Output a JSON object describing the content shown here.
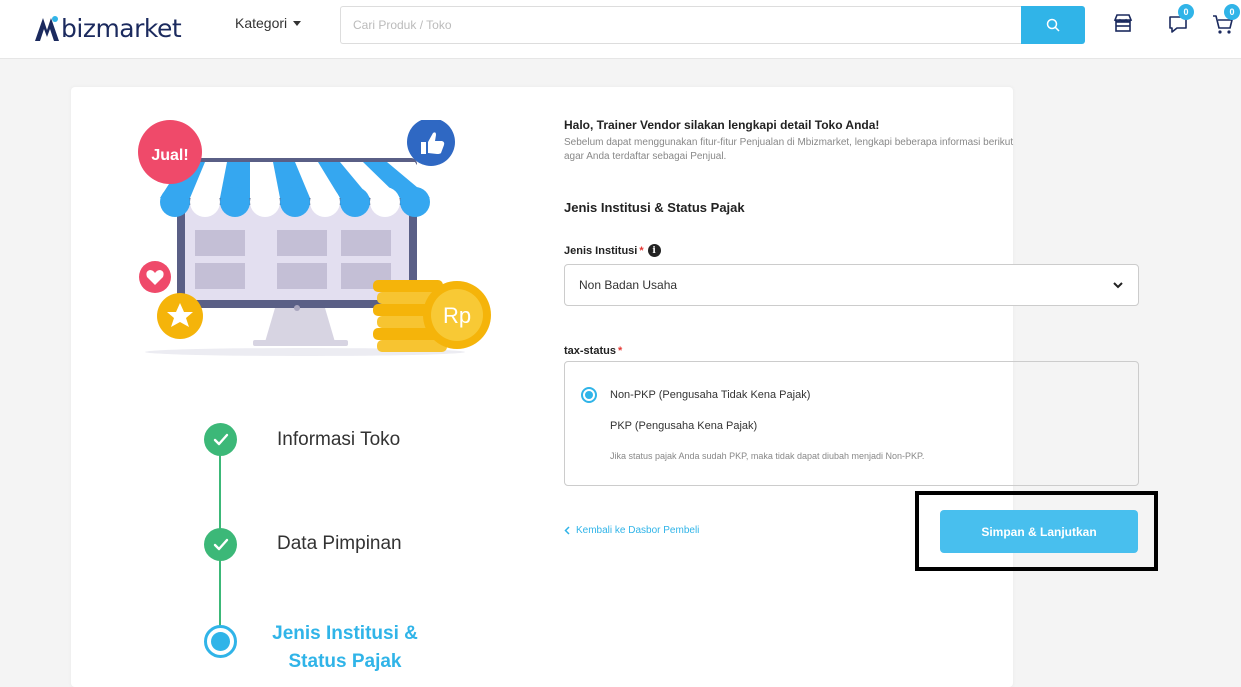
{
  "header": {
    "logo_text": "bizmarket",
    "category_label": "Kategori",
    "search_placeholder": "Cari Produk / Toko",
    "chat_badge": "0",
    "cart_badge": "0"
  },
  "illustration": {
    "sale_badge": "Jual!",
    "currency_symbol": "Rp"
  },
  "stepper": {
    "steps": [
      {
        "label": "Informasi Toko",
        "status": "done"
      },
      {
        "label": "Data Pimpinan",
        "status": "done"
      },
      {
        "label": "Jenis Institusi & Status Pajak",
        "status": "current",
        "line1": "Jenis Institusi &",
        "line2": "Status Pajak"
      }
    ]
  },
  "form": {
    "greeting": "Halo, Trainer Vendor silakan lengkapi detail Toko Anda!",
    "greeting_sub": "Sebelum dapat menggunakan fitur-fitur Penjualan di Mbizmarket, lengkapi beberapa informasi berikut agar Anda terdaftar sebagai Penjual.",
    "section_title": "Jenis Institusi & Status Pajak",
    "institution_label": "Jenis Institusi",
    "institution_value": "Non Badan Usaha",
    "tax_label": "tax-status",
    "tax_options": [
      {
        "label": "Non-PKP (Pengusaha Tidak Kena Pajak)",
        "selected": true
      },
      {
        "label": "PKP (Pengusaha Kena Pajak)",
        "selected": false
      }
    ],
    "tax_note": "Jika status pajak Anda sudah PKP, maka tidak dapat diubah menjadi Non-PKP.",
    "back_label": "Kembali ke Dasbor Pembeli",
    "save_label": "Simpan & Lanjutkan"
  },
  "colors": {
    "accent": "#30b4e8",
    "done": "#3cb878",
    "required": "#e53935"
  }
}
